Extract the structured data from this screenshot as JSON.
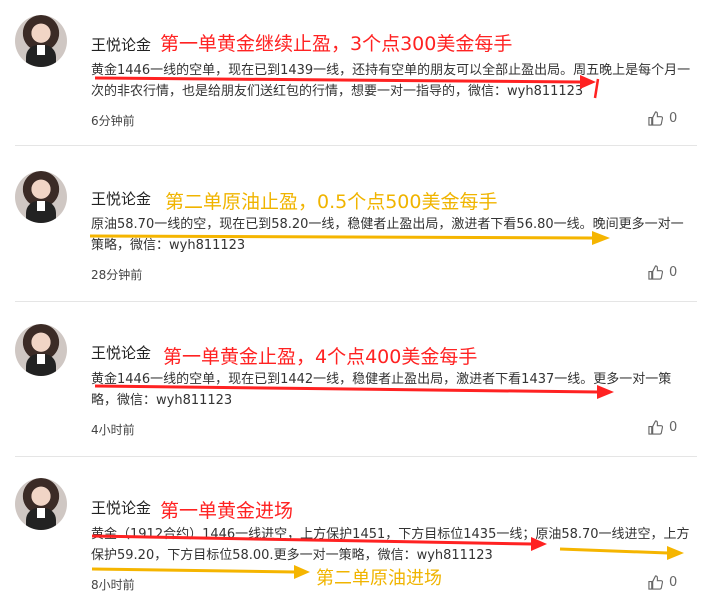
{
  "colors": {
    "red": "#ff2222",
    "yellow": "#f0b400"
  },
  "posts": [
    {
      "author": "王悦论金",
      "headline": "第一单黄金继续止盈，3个点300美金每手",
      "headline_color": "#ff2222",
      "text": "黄金1446一线的空单，现在已到1439一线，还持有空单的朋友可以全部止盈出局。周五晚上是每个月一次的非农行情，也是给朋友们送红包的行情，想要一对一指导的，微信：wyh811123",
      "time": "6分钟前",
      "likes": "0"
    },
    {
      "author": "王悦论金",
      "headline": "第二单原油止盈，0.5个点500美金每手",
      "headline_color": "#f0b400",
      "text": "原油58.70一线的空，现在已到58.20一线，稳健者止盈出局，激进者下看56.80一线。晚间更多一对一策略，微信：wyh811123",
      "time": "28分钟前",
      "likes": "0"
    },
    {
      "author": "王悦论金",
      "headline": "第一单黄金止盈，4个点400美金每手",
      "headline_color": "#ff2222",
      "text": "黄金1446一线的空单，现在已到1442一线，稳健者止盈出局，激进者下看1437一线。更多一对一策略，微信：wyh811123",
      "time": "4小时前",
      "likes": "0"
    },
    {
      "author": "王悦论金",
      "headline": "第一单黄金进场",
      "headline_color": "#ff2222",
      "text": "黄金（1912合约）1446一线进空，上方保护1451，下方目标位1435一线；原油58.70一线进空，上方保护59.20，下方目标位58.00.更多一对一策略，微信：wyh811123",
      "time": "8小时前",
      "likes": "0",
      "annotation": "第二单原油进场"
    }
  ]
}
